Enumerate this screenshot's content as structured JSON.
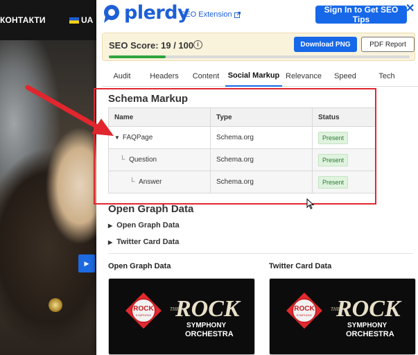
{
  "site": {
    "nav_label": "КОНТАКТИ",
    "lang_label": "UA",
    "side_button_icon": "play-icon"
  },
  "panel": {
    "brand": "plerdy",
    "extension_label": "SEO Extension",
    "signin_label": "Sign In to Get SEO Tips",
    "close_icon": "close-icon",
    "score": {
      "label": "SEO Score: 19 / 100",
      "value": 19,
      "max": 100,
      "download_label": "Download PNG",
      "pdf_label": "PDF Report"
    },
    "tabs": [
      "Audit",
      "Headers",
      "Content",
      "Social Markup",
      "Relevance",
      "Speed",
      "Tech"
    ],
    "active_tab": "Social Markup",
    "schema": {
      "heading": "Schema Markup",
      "columns": [
        "Name",
        "Type",
        "Status"
      ],
      "rows": [
        {
          "name": "FAQPage",
          "type": "Schema.org",
          "status": "Present"
        },
        {
          "name": "Question",
          "type": "Schema.org",
          "status": "Present"
        },
        {
          "name": "Answer",
          "type": "Schema.org",
          "status": "Present"
        }
      ]
    },
    "og": {
      "heading": "Open Graph Data",
      "collapsibles": [
        "Open Graph Data",
        "Twitter Card Data"
      ],
      "card_titles": [
        "Open Graph Data",
        "Twitter Card Data"
      ],
      "card_logo": {
        "badge_text": "ROCK",
        "badge_sub": "SYMPHONY",
        "the": "THE",
        "rock": "ROCK",
        "symphony": "SYMPHONY",
        "orchestra": "ORCHESTRA"
      }
    }
  },
  "colors": {
    "brand_blue": "#1668e8",
    "annotation_red": "#e1262d",
    "progress_green": "#2fa43c",
    "score_bg": "#faf3dc"
  }
}
